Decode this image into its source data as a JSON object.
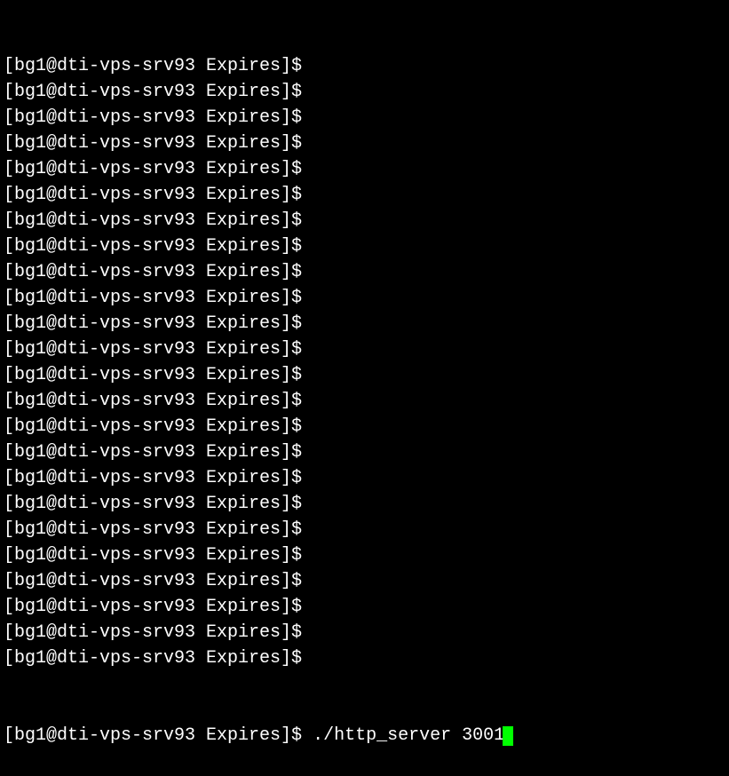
{
  "terminal": {
    "prompt": "[bg1@dti-vps-srv93 Expires]$ ",
    "empty_lines_count": 24,
    "command": "./http_server 3001"
  }
}
